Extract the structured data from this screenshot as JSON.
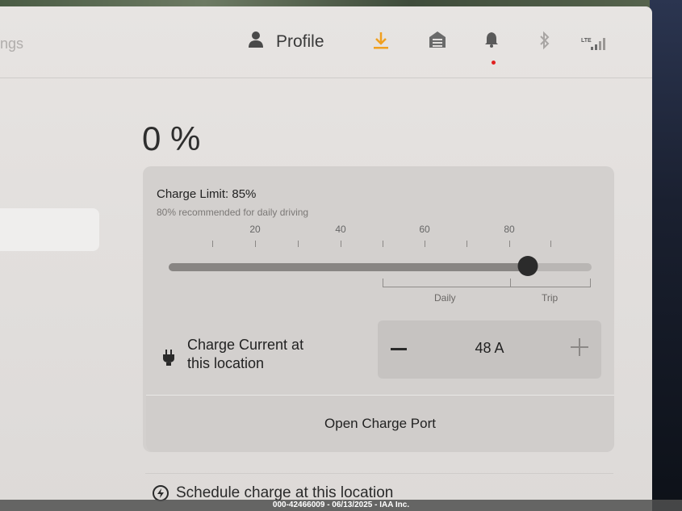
{
  "topbar": {
    "settings_fragment": "ngs",
    "profile_label": "Profile",
    "lte_label": "LTE",
    "accent_color": "#f0a020"
  },
  "battery": {
    "percent_text": "0 %"
  },
  "charge_limit": {
    "label": "Charge Limit: 85%",
    "value_percent": 85,
    "recommendation": "80% recommended for daily driving",
    "tick_labels": [
      "20",
      "40",
      "60",
      "80"
    ],
    "range_labels": {
      "daily": "Daily",
      "trip": "Trip"
    }
  },
  "charge_current": {
    "label_line1": "Charge Current at",
    "label_line2": "this location",
    "value": "48 A"
  },
  "open_charge_port": {
    "label": "Open Charge Port"
  },
  "schedule": {
    "label": "Schedule charge at this location"
  },
  "watermark": {
    "text": "000-42466009 - 06/13/2025 - IAA Inc."
  },
  "icons": [
    "person-icon",
    "download-icon",
    "garage-icon",
    "bell-icon",
    "bluetooth-icon",
    "signal-icon",
    "plug-icon",
    "clock-bolt-icon"
  ]
}
